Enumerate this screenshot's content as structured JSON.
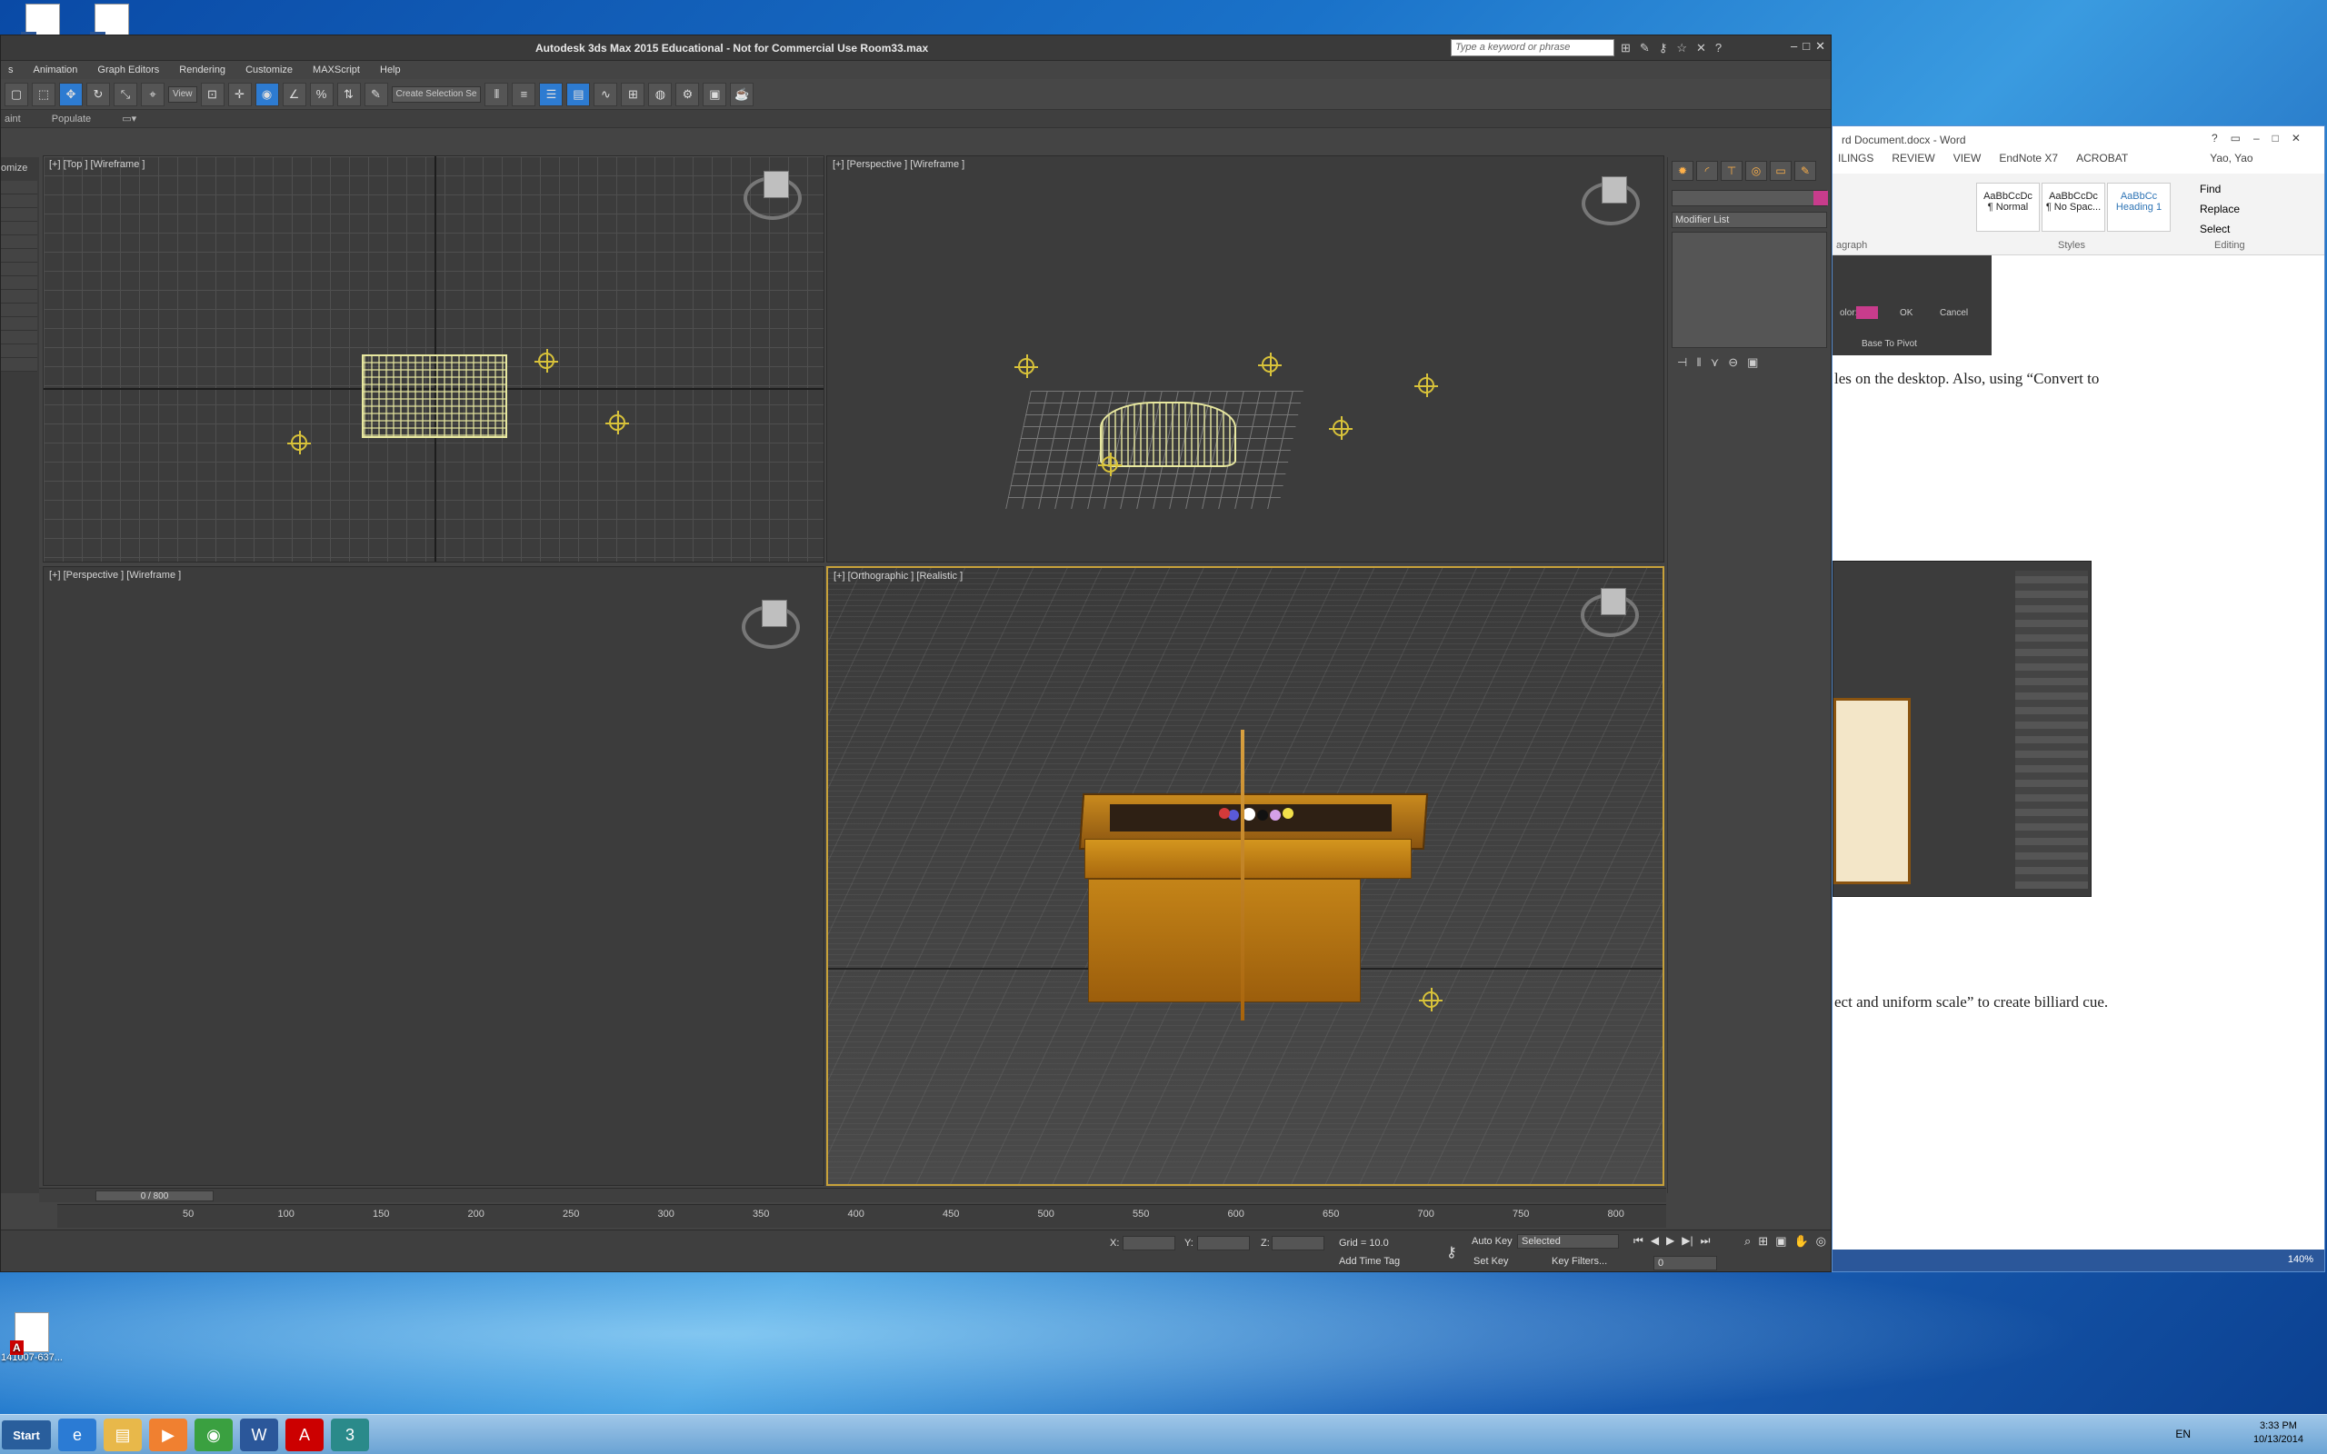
{
  "max": {
    "title": "Autodesk 3ds Max  2015  Educational - Not for Commercial Use    Room33.max",
    "search_placeholder": "Type a keyword or phrase",
    "menu": [
      "s",
      "Animation",
      "Graph Editors",
      "Rendering",
      "Customize",
      "MAXScript",
      "Help"
    ],
    "toolbar": {
      "view_dd": "View",
      "selset_dd": "Create Selection Se"
    },
    "subbar": [
      "aint",
      "Populate"
    ],
    "left_label": "omize",
    "viewports": {
      "top": "[+] [Top ] [Wireframe ]",
      "persp1": "[+] [Perspective ] [Wireframe ]",
      "persp2": "[+] [Perspective ] [Wireframe ]",
      "ortho": "[+] [Orthographic ] [Realistic ]"
    },
    "cmd": {
      "modifier_list": "Modifier List"
    },
    "time": {
      "slider": "0 / 800",
      "ticks": [
        "50",
        "100",
        "150",
        "200",
        "250",
        "300",
        "350",
        "400",
        "450",
        "500",
        "550",
        "600",
        "650",
        "700",
        "750",
        "800"
      ]
    },
    "status": {
      "x": "X:",
      "y": "Y:",
      "z": "Z:",
      "grid": "Grid = 10.0",
      "autokey": "Auto Key",
      "selected": "Selected",
      "setkey": "Set Key",
      "keyfilters": "Key Filters...",
      "addtimetag": "Add Time Tag",
      "frame": "0"
    }
  },
  "word": {
    "title": "rd Document.docx - Word",
    "user": "Yao, Yao",
    "tabs": [
      "ILINGS",
      "REVIEW",
      "VIEW",
      "EndNote X7",
      "ACROBAT"
    ],
    "styles": [
      {
        "sample": "AaBbCcDc",
        "name": "¶ Normal"
      },
      {
        "sample": "AaBbCcDc",
        "name": "¶ No Spac..."
      },
      {
        "sample": "AaBbCc",
        "name": "Heading 1"
      }
    ],
    "groups": {
      "paragraph": "agraph",
      "styles": "Styles",
      "editing": "Editing"
    },
    "editing": [
      "Find",
      "Replace",
      "Select"
    ],
    "dialog": {
      "color_label": "olor:",
      "ok": "OK",
      "cancel": "Cancel",
      "base": "Base To Pivot"
    },
    "text1": "les on the desktop. Also, using “Convert to",
    "text2": "ect and uniform scale” to create billiard cue.",
    "zoom": "140%"
  },
  "taskbar": {
    "start": "Start",
    "lang": "EN",
    "time": "3:33 PM",
    "date": "10/13/2014"
  },
  "desktop": {
    "icon_label": "141007-637..."
  }
}
